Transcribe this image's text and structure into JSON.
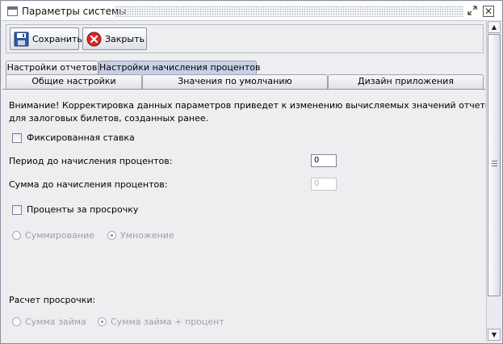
{
  "window": {
    "title": "Параметры системы",
    "restore_glyph": "⬋⬈",
    "close_glyph": "✕"
  },
  "toolbar": {
    "save_label": "Сохранить",
    "close_label": "Закрыть"
  },
  "tabs": {
    "row1": [
      {
        "label": "Настройки отчетов",
        "active": false
      },
      {
        "label": "Настройки начисления процентов",
        "active": true
      }
    ],
    "row2": [
      {
        "label": "Общие настройки"
      },
      {
        "label": "Значения по умолчанию"
      },
      {
        "label": "Дизайн приложения"
      }
    ]
  },
  "content": {
    "warning_line1": "Внимание! Корректировка данных параметров приведет к изменению вычисляемых значений отчетов",
    "warning_line2": "для залоговых билетов, созданных ранее.",
    "fixed_rate_label": "Фиксированная ставка",
    "fixed_rate_checked": false,
    "period_label": "Период до начисления процентов:",
    "period_value": "0",
    "sum_label": "Сумма до начисления процентов:",
    "sum_value": "0",
    "overdue_interest_label": "Проценты за просрочку",
    "overdue_interest_checked": false,
    "mode_options": [
      {
        "label": "Суммирование",
        "selected": false
      },
      {
        "label": "Умножение",
        "selected": true
      }
    ],
    "overdue_calc_label": "Расчет просрочки:",
    "overdue_calc_options": [
      {
        "label": "Сумма займа",
        "selected": false
      },
      {
        "label": "Сумма займа + процент",
        "selected": true
      }
    ]
  },
  "colors": {
    "active_tab": "#c7d1e6",
    "disabled_text": "#9da0a8"
  }
}
